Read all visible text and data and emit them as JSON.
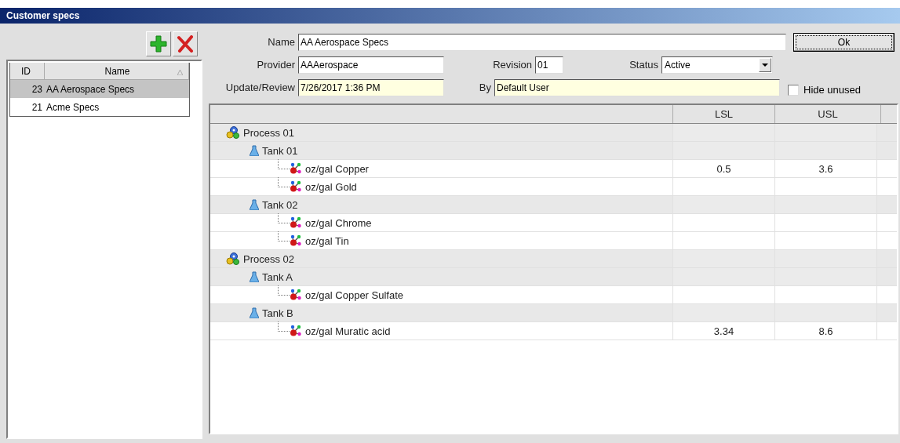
{
  "window": {
    "title": "Customer specs"
  },
  "specs_list": {
    "columns": [
      "ID",
      "Name"
    ],
    "rows": [
      {
        "id": "23",
        "name": "AA Aerospace Specs",
        "selected": true
      },
      {
        "id": "21",
        "name": "Acme Specs",
        "selected": false
      }
    ]
  },
  "form": {
    "name_label": "Name",
    "name": "AA Aerospace Specs",
    "ok_button": "Ok",
    "provider_label": "Provider",
    "provider": "AAAerospace",
    "revision_label": "Revision",
    "revision": "01",
    "status_label": "Status",
    "status": "Active",
    "update_label": "Update/Review",
    "update": "7/26/2017 1:36 PM",
    "by_label": "By",
    "by": "Default User",
    "hide_unused": {
      "label": "Hide unused",
      "checked": false
    }
  },
  "grid": {
    "columns": [
      "LSL",
      "USL"
    ],
    "tree": [
      {
        "label": "Process 01",
        "children": [
          {
            "label": "Tank 01",
            "children": [
              {
                "label": "oz/gal Copper",
                "lsl": "0.5",
                "usl": "3.6"
              },
              {
                "label": "oz/gal Gold"
              }
            ]
          },
          {
            "label": "Tank 02",
            "children": [
              {
                "label": "oz/gal Chrome"
              },
              {
                "label": "oz/gal Tin"
              }
            ]
          }
        ]
      },
      {
        "label": "Process 02",
        "children": [
          {
            "label": "Tank A",
            "children": [
              {
                "label": "oz/gal Copper Sulfate"
              }
            ]
          },
          {
            "label": "Tank B",
            "children": [
              {
                "label": "oz/gal Muratic acid",
                "lsl": "3.34",
                "usl": "8.6"
              }
            ]
          }
        ]
      }
    ]
  }
}
